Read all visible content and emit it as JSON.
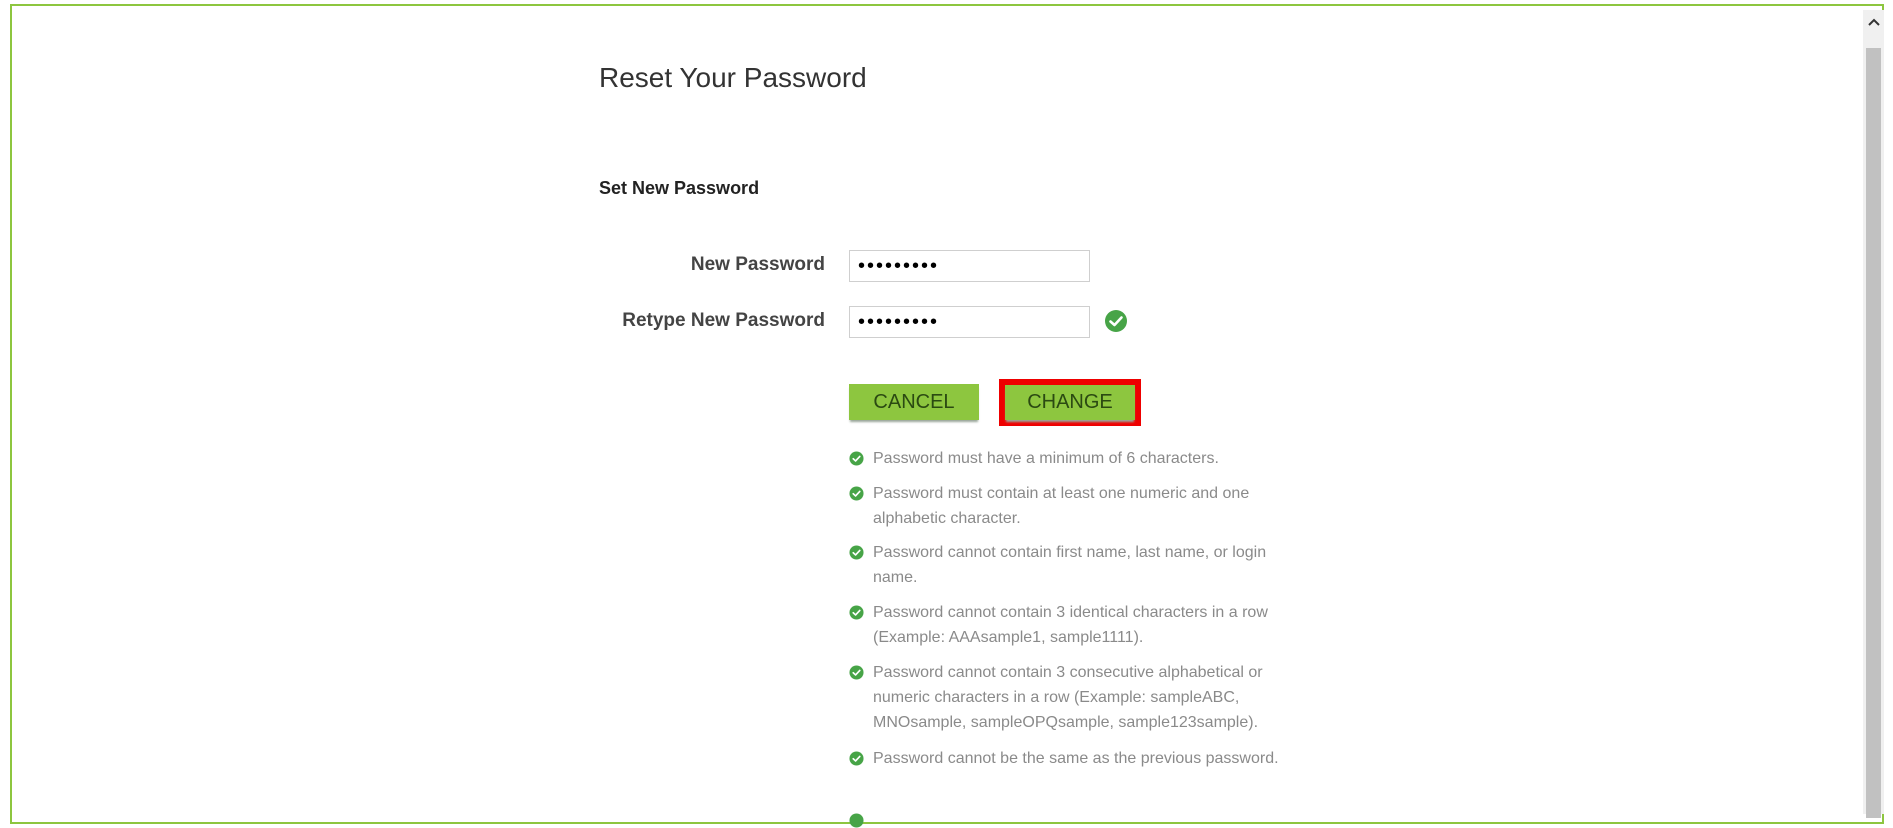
{
  "page": {
    "title": "Reset Your Password",
    "section_title": "Set New Password"
  },
  "form": {
    "new_password": {
      "label": "New Password",
      "value": "•••••••••"
    },
    "retype_password": {
      "label": "Retype New Password",
      "value": "•••••••••"
    }
  },
  "buttons": {
    "cancel_label": "CANCEL",
    "change_label": "CHANGE"
  },
  "rules": [
    "Password must have a minimum of 6 characters.",
    "Password must contain at least one numeric and one alphabetic character.",
    "Password cannot contain first name, last name, or login name.",
    "Password cannot contain 3 identical characters in a row (Example: AAAsample1, sample1111).",
    "Password cannot contain 3 consecutive alphabetical or numeric characters in a row (Example: sampleABC, MNOsample, sampleOPQsample, sample123sample).",
    "Password cannot be the same as the previous password."
  ],
  "colors": {
    "accent": "#8dc63f",
    "highlight": "#ee0000",
    "check": "#47a447"
  },
  "icons": {
    "check": "check-circle-icon",
    "scroll_up": "chevron-up-icon"
  }
}
